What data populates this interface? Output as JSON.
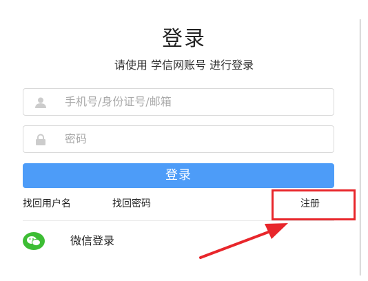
{
  "login": {
    "title": "登录",
    "subtitle": "请使用 学信网账号 进行登录",
    "username_placeholder": "手机号/身份证号/邮箱",
    "password_placeholder": "密码",
    "login_button": "登录"
  },
  "links": {
    "find_username": "找回用户名",
    "find_password": "找回密码",
    "register": "注册"
  },
  "wechat": {
    "label": "微信登录"
  },
  "colors": {
    "primary_button": "#4d9cf8",
    "annotation_red": "#e8262b",
    "wechat_green": "#3dbd34"
  },
  "icons": {
    "user": "user-icon",
    "lock": "lock-icon",
    "wechat": "wechat-icon",
    "arrow": "annotation-arrow"
  }
}
